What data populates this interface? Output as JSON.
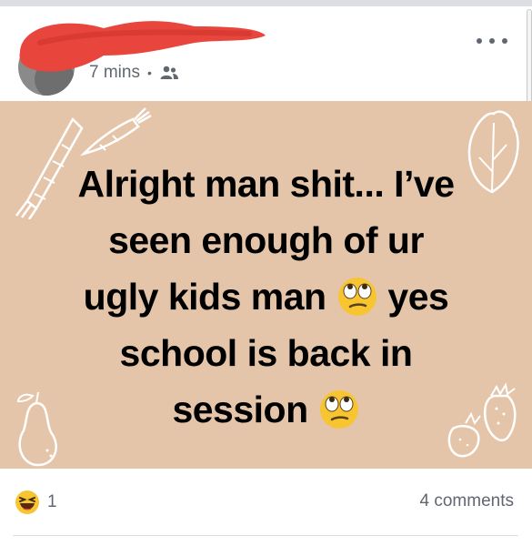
{
  "post": {
    "timestamp": "7 mins",
    "separator": "•",
    "audience_icon": "friends-icon",
    "more_icon": "more-options-icon",
    "text_lines": [
      "Alright man shit... I’ve",
      "seen enough of ur",
      "ugly kids man",
      "yes",
      "school is back in",
      "session"
    ],
    "emoji_name": "face-with-rolling-eyes-emoji",
    "background_color": "#e5c5a9",
    "decorations": [
      "carrot-icon",
      "carrot-icon",
      "lettuce-icon",
      "pear-icon",
      "strawberry-icon",
      "strawberry-icon"
    ]
  },
  "footer": {
    "reaction_icon": "haha-reaction-icon",
    "reaction_count": "1",
    "comments_label": "4 comments"
  },
  "colors": {
    "redaction": "#e8453c",
    "meta_text": "#606770"
  }
}
